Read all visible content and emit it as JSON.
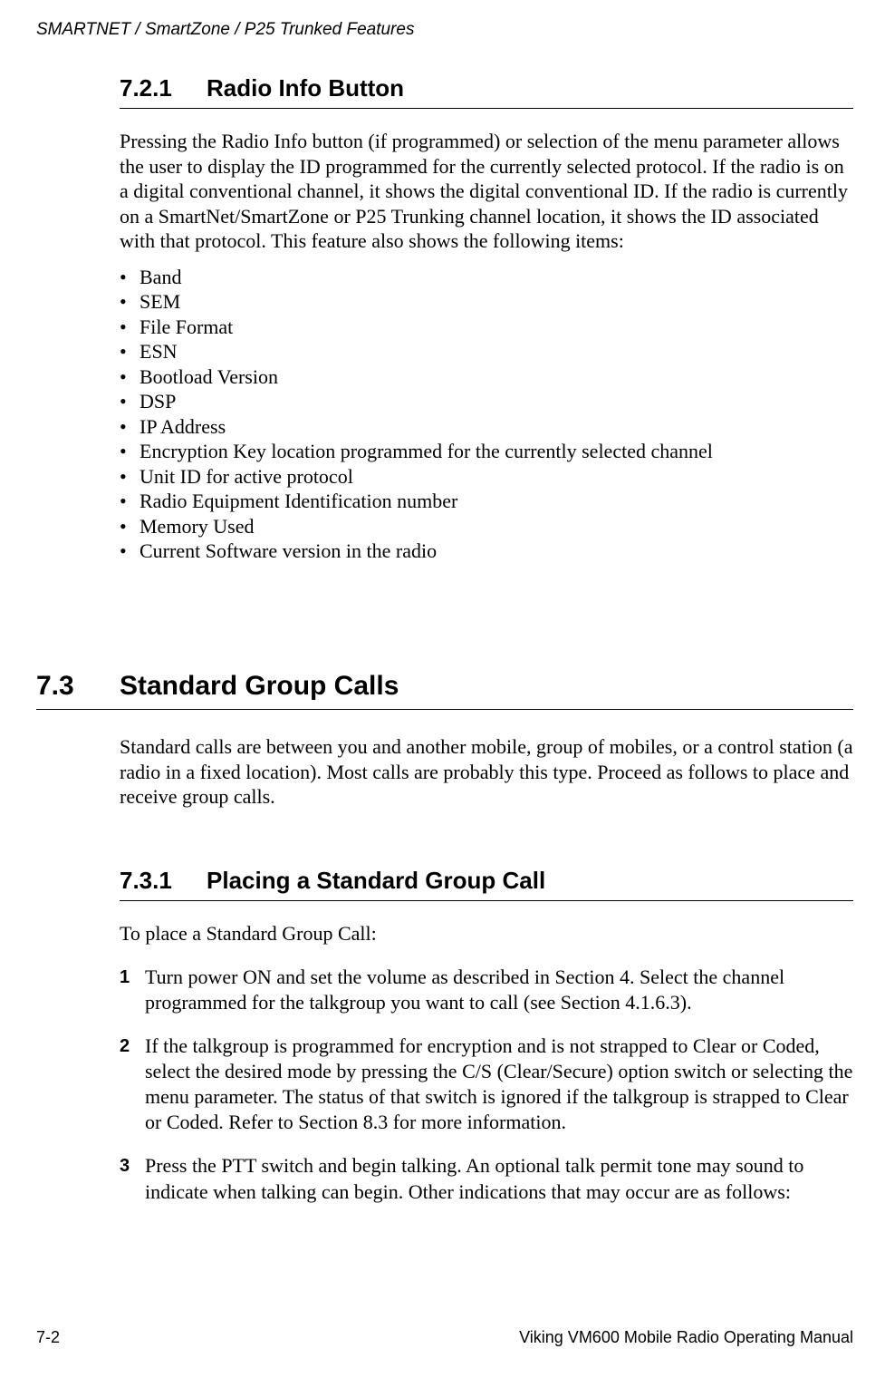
{
  "header": {
    "running": "SMARTNET / SmartZone / P25 Trunked Features"
  },
  "section_721": {
    "number": "7.2.1",
    "title": "Radio Info Button",
    "intro": "Pressing the Radio Info button (if programmed) or selection of the menu parameter allows the user to display the ID programmed for the currently selected protocol. If the radio is on a digital conventional channel, it shows the digital conventional ID. If the radio is currently on a SmartNet/SmartZone or P25 Trunking channel location, it shows the ID associated with that protocol. This feature also shows the following items:",
    "bullets": [
      "Band",
      "SEM",
      "File Format",
      "ESN",
      "Bootload Version",
      "DSP",
      "IP Address",
      "Encryption Key location programmed for the currently selected channel",
      "Unit ID for active protocol",
      "Radio Equipment Identification number",
      "Memory Used",
      "Current Software version in the radio"
    ]
  },
  "section_73": {
    "number": "7.3",
    "title": "Standard Group Calls",
    "intro": "Standard calls are between you and another mobile, group of mobiles, or a control station (a radio in a fixed location). Most calls are probably this type. Proceed as follows to place and receive group calls."
  },
  "section_731": {
    "number": "7.3.1",
    "title": "Placing a Standard Group Call",
    "lead": "To place a Standard Group Call:",
    "steps": [
      {
        "n": "1",
        "text": "Turn power ON and set the volume as described in Section 4. Select the channel programmed for the talkgroup you want to call (see Section 4.1.6.3)."
      },
      {
        "n": "2",
        "text": "If the talkgroup is programmed for encryption and is not strapped to Clear or Coded, select the desired mode by pressing the C/S (Clear/Secure) option switch or selecting the menu parameter. The status of that switch is ignored if the talkgroup is strapped to Clear or Coded. Refer to Section 8.3 for more information."
      },
      {
        "n": "3",
        "text": "Press the PTT switch and begin talking. An optional talk permit tone may sound to indicate when talking can begin. Other indications that may occur are as follows:"
      }
    ]
  },
  "footer": {
    "page": "7-2",
    "doc": "Viking VM600 Mobile Radio Operating Manual"
  }
}
